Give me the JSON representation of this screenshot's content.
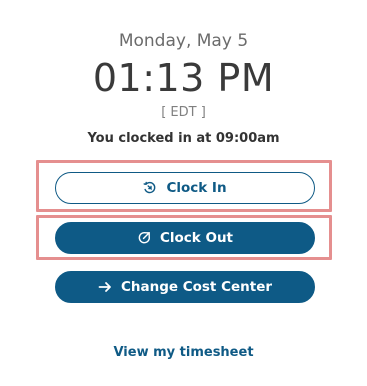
{
  "header": {
    "date": "Monday, May 5",
    "time": "01:13 PM",
    "timezone": "[ EDT ]",
    "status": "You clocked in at 09:00am"
  },
  "actions": {
    "clock_in_label": "Clock In",
    "clock_out_label": "Clock Out",
    "change_cost_center_label": "Change Cost Center"
  },
  "links": {
    "timesheet_label": "View my timesheet"
  },
  "colors": {
    "primary": "#0e5a86",
    "highlight": "#e58f8f"
  },
  "icons": {
    "clock_in": "clock-in-icon",
    "clock_out": "clock-out-icon",
    "change_cost_center": "arrow-right-icon"
  }
}
